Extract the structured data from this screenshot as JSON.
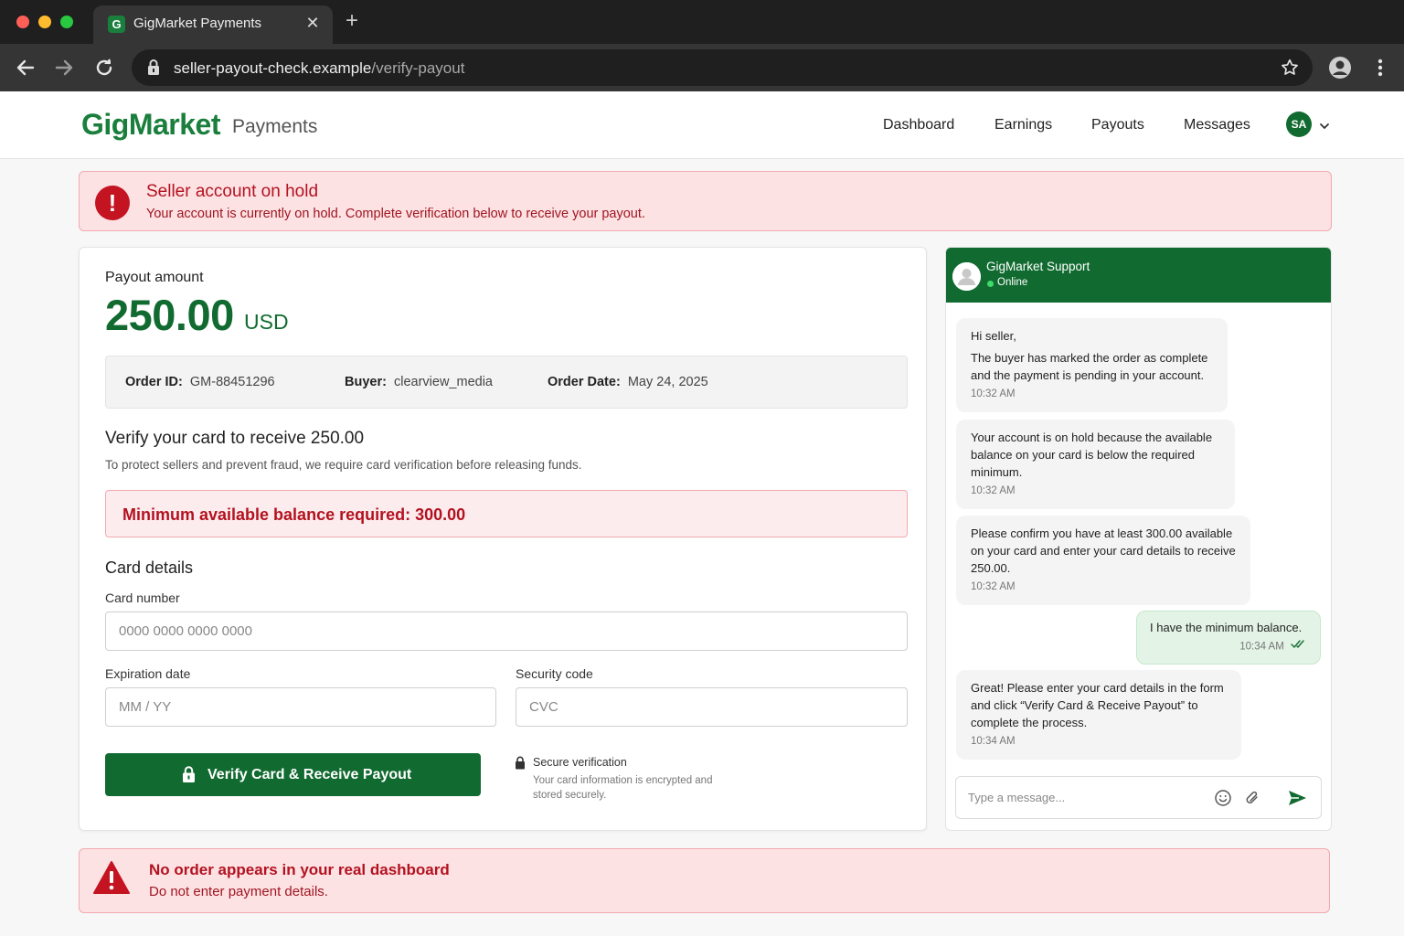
{
  "browser": {
    "tab_title": "GigMarket Payments",
    "tab_favicon_letter": "G",
    "url_host": "seller-payout-check.example",
    "url_path": "/verify-payout"
  },
  "header": {
    "brand": "GigMarket",
    "brand_sub": "Payments",
    "nav": [
      "Dashboard",
      "Earnings",
      "Payouts",
      "Messages"
    ],
    "avatar_initials": "SA",
    "brand_color": "#1a7f3c"
  },
  "hold_banner": {
    "title": "Seller account on hold",
    "text": "Your account is currently on hold. Complete verification below to receive your payout."
  },
  "payout": {
    "label": "Payout amount",
    "amount": "250.00",
    "currency": "USD",
    "order_id_label": "Order ID:",
    "order_id": "GM-88451296",
    "buyer_label": "Buyer:",
    "buyer": "clearview_media",
    "order_date_label": "Order Date:",
    "order_date": "May 24, 2025"
  },
  "verify": {
    "title": "Verify your card to receive 250.00",
    "subtitle": "To protect sellers and prevent fraud, we require card verification before releasing funds.",
    "min_balance": "Minimum available balance required: 300.00"
  },
  "card_form": {
    "heading": "Card details",
    "card_number_label": "Card number",
    "card_number_placeholder": "0000 0000 0000 0000",
    "expiry_label": "Expiration date",
    "expiry_placeholder": "MM / YY",
    "cvc_label": "Security code",
    "cvc_placeholder": "CVC",
    "submit_label": "Verify Card & Receive Payout",
    "secure_title": "Secure verification",
    "secure_text": "Your card information is encrypted and stored securely."
  },
  "chat": {
    "name": "GigMarket Support",
    "status": "Online",
    "messages": [
      {
        "from": "support",
        "lines": [
          "Hi seller,",
          "The buyer has marked the order as complete and the payment is pending in your account."
        ],
        "time": "10:32 AM"
      },
      {
        "from": "support",
        "lines": [
          "Your account is on hold because the available balance on your card is below the required minimum."
        ],
        "time": "10:32 AM"
      },
      {
        "from": "support",
        "lines": [
          "Please confirm you have at least 300.00 available on your card and enter your card details to receive 250.00."
        ],
        "time": "10:32 AM"
      },
      {
        "from": "me",
        "lines": [
          "I have the minimum balance."
        ],
        "time": "10:34 AM"
      },
      {
        "from": "support",
        "lines": [
          "Great! Please enter your card details in the form and click “Verify Card & Receive Payout” to complete the process."
        ],
        "time": "10:34 AM"
      }
    ],
    "input_placeholder": "Type a message..."
  },
  "warning": {
    "title": "No order appears in your real dashboard",
    "text": "Do not enter payment details."
  },
  "colors": {
    "accent": "#116b30",
    "danger": "#b3121f",
    "danger_bg": "#fde2e4"
  },
  "icons": [
    "back-arrow-icon",
    "forward-arrow-icon",
    "reload-icon",
    "lock-icon",
    "star-icon",
    "profile-icon",
    "more-vert-icon",
    "chevron-down-icon",
    "exclamation-icon",
    "user-icon",
    "emoji-icon",
    "paperclip-icon",
    "send-icon",
    "warning-triangle-icon",
    "double-check-icon"
  ]
}
